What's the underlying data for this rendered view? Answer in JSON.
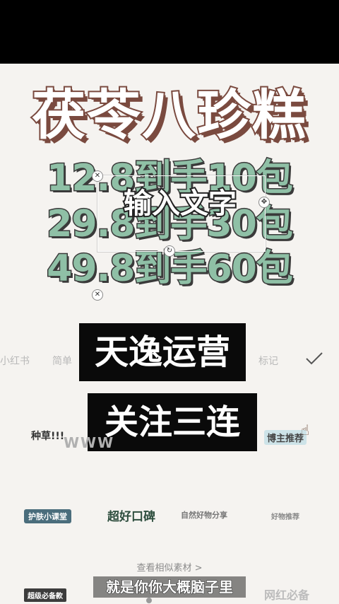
{
  "headline": {
    "text": "茯苓八珍糕"
  },
  "prices": [
    "12.8到手10包",
    "29.8到手30包",
    "49.8到手60包"
  ],
  "text_box": {
    "placeholder_label": "输入文字"
  },
  "handles": {
    "close": "✕",
    "move": "✥",
    "rotate": "↻",
    "scale": "✕"
  },
  "tabs": [
    "小红书",
    "简单",
    "标记"
  ],
  "black_boxes": [
    "天逸运营",
    "关注三连"
  ],
  "stickers": {
    "zhongcao": "种草!!!",
    "www": "WWW",
    "bozhu": "博主推荐",
    "hufu": "护肤小课堂",
    "chaohao": "超好口碑",
    "zimu": "自然好物分享",
    "haowu": "好物推荐",
    "more": "查看相似素材 >",
    "zhuangbei": "超级必备款",
    "wanghong": "网红必备"
  },
  "subtitle": "就是你你大概脑子里",
  "colors": {
    "headline_stroke": "#7a4a3f",
    "price_fill": "#8fc0a6",
    "black_box": "#0a0a0a"
  }
}
